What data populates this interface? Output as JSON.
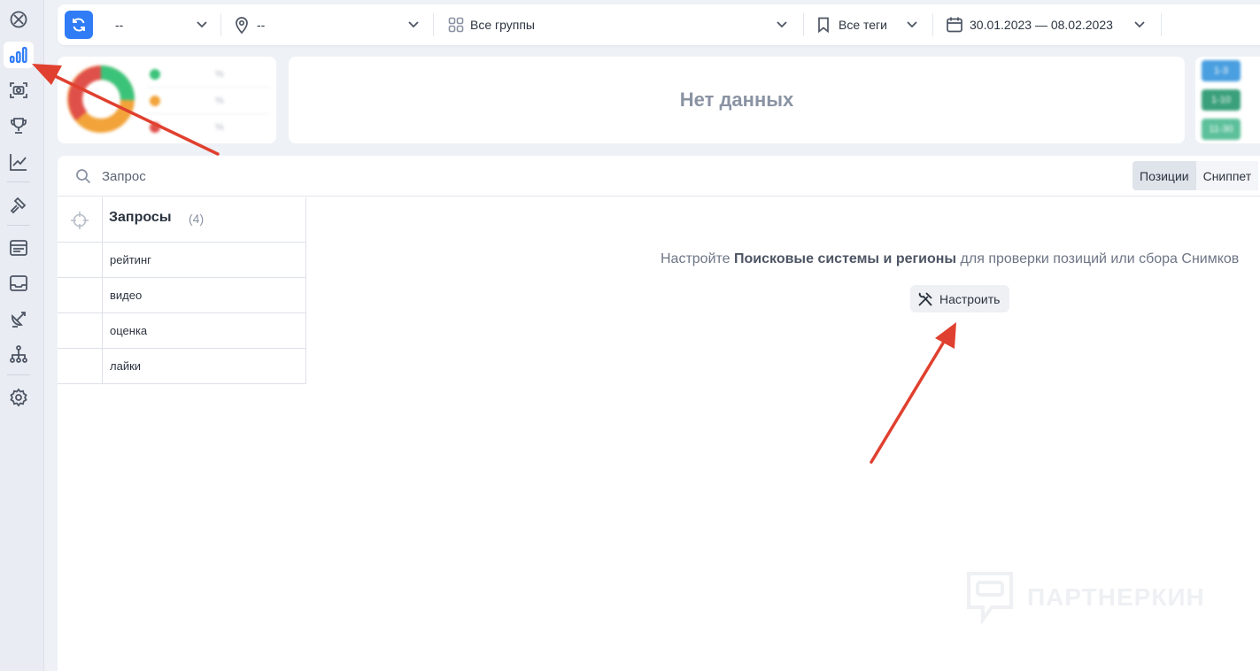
{
  "sidebar": {
    "items": [
      {
        "icon": "logo-icon"
      },
      {
        "icon": "bar-chart-icon",
        "active": true
      },
      {
        "icon": "screenshot-camera-icon"
      },
      {
        "icon": "trophy-icon"
      },
      {
        "icon": "trend-line-icon"
      },
      {
        "icon": "hammer-icon"
      },
      {
        "icon": "serp-icon"
      },
      {
        "icon": "inbox-icon"
      },
      {
        "icon": "satellite-icon"
      },
      {
        "icon": "sitemap-icon"
      },
      {
        "icon": "settings-icon"
      }
    ]
  },
  "topbar": {
    "search_engine": "--",
    "region": "--",
    "groups": "Все группы",
    "tags": "Все теги",
    "date_range": "30.01.2023 — 08.02.2023"
  },
  "stats": {
    "legend": [
      {
        "color": "#2ecc71",
        "pct": "%"
      },
      {
        "color": "#f5a623",
        "pct": "%"
      },
      {
        "color": "#e74c3c",
        "pct": "%"
      }
    ],
    "no_data": "Нет данных",
    "badges": [
      {
        "label": "1-3",
        "color": "#4a9fe0"
      },
      {
        "label": "1-10",
        "color": "#3aa07b"
      },
      {
        "label": "11-30",
        "color": "#5cc09a"
      }
    ]
  },
  "main": {
    "search_placeholder": "Запрос",
    "view_tabs": [
      "Позиции",
      "Сниппет"
    ],
    "queries_title": "Запросы",
    "queries_count": "(4)",
    "queries": [
      "рейтинг",
      "видео",
      "оценка",
      "лайки"
    ],
    "hint_prefix": "Настройте ",
    "hint_bold": "Поисковые системы и регионы",
    "hint_suffix": " для проверки позиций или сбора Снимков",
    "configure_label": "Настроить"
  },
  "watermark": "ПАРТНЕРКИН",
  "colors": {
    "accent": "#2f7cf6",
    "annotation_arrow": "#e0402f"
  }
}
